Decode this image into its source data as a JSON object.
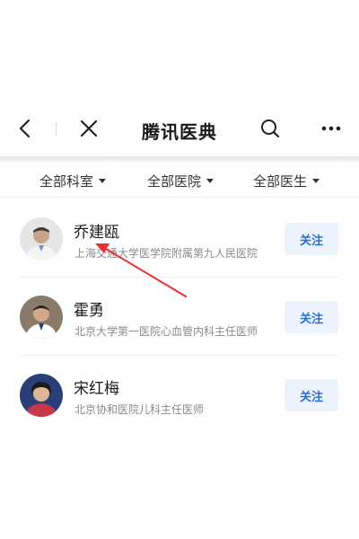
{
  "navbar": {
    "title": "腾讯医典",
    "icons": [
      "back-icon",
      "close-icon",
      "search-icon",
      "more-icon"
    ]
  },
  "filters": [
    {
      "label": "全部科室"
    },
    {
      "label": "全部医院"
    },
    {
      "label": "全部医生"
    }
  ],
  "doctors": [
    {
      "name": "乔建瓯",
      "desc": "上海交通大学医学院附属第九人民医院",
      "follow_label": "关注"
    },
    {
      "name": "霍勇",
      "desc": "北京大学第一医院心血管内科主任医师",
      "follow_label": "关注"
    },
    {
      "name": "宋红梅",
      "desc": "北京协和医院儿科主任医师",
      "follow_label": "关注"
    }
  ],
  "colors": {
    "accent": "#2b6fd6",
    "follow_bg": "#eef4fd",
    "annotation_arrow": "#e8312f"
  }
}
